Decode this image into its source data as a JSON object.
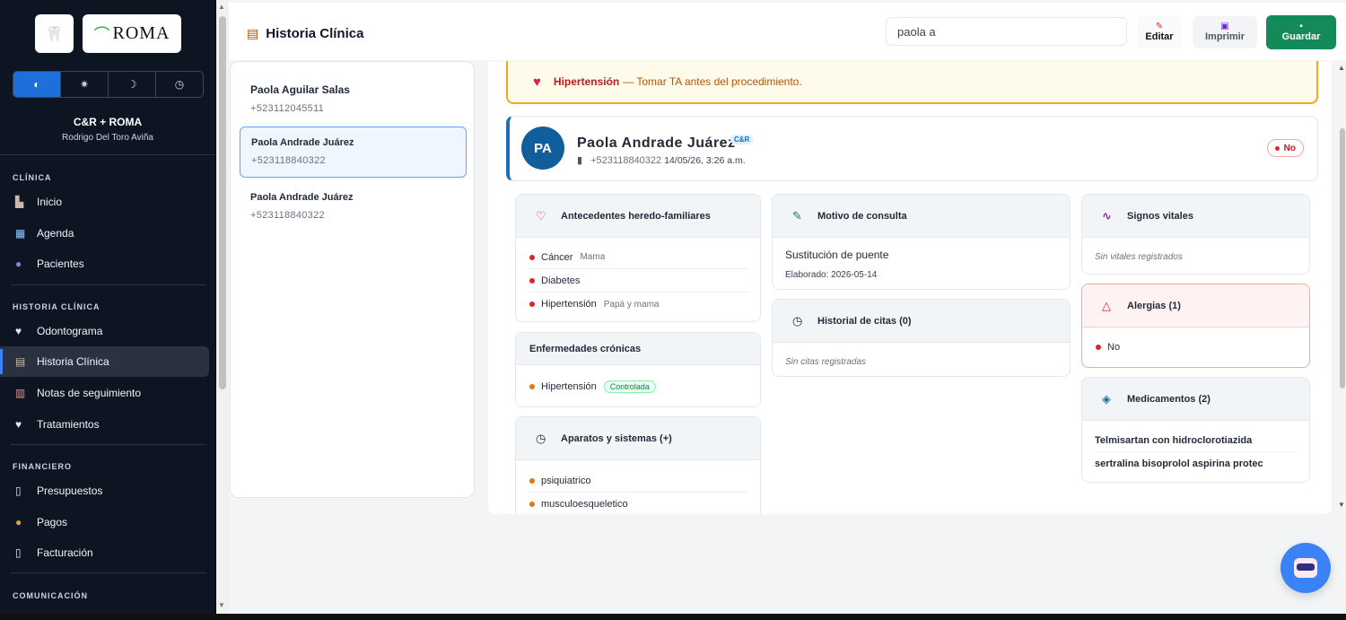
{
  "sidebar": {
    "logo_small_text": "C&R",
    "logo_brand": "ROMA",
    "theme_options": [
      {
        "icon": "contrast-icon",
        "glyph": "◐"
      },
      {
        "icon": "sun-icon",
        "glyph": "✷"
      },
      {
        "icon": "moon-icon",
        "glyph": "☽"
      },
      {
        "icon": "clock-icon",
        "glyph": "◷"
      }
    ],
    "clinic_name": "C&R + ROMA",
    "user_name": "Rodrigo Del Toro Aviña",
    "sections": {
      "clinica": "CLÍNICA",
      "historia": "HISTORIA CLÍNICA",
      "financiero": "FINANCIERO",
      "comunicacion": "COMUNICACIÓN"
    },
    "items": {
      "inicio": "Inicio",
      "agenda": "Agenda",
      "pacientes": "Pacientes",
      "odontograma": "Odontograma",
      "historia_clinica": "Historia Clínica",
      "notas": "Notas de seguimiento",
      "tratamientos": "Tratamientos",
      "presupuestos": "Presupuestos",
      "pagos": "Pagos",
      "facturacion": "Facturación"
    }
  },
  "header": {
    "title": "Historia Clínica",
    "search_value": "paola a",
    "edit_label": "Editar",
    "print_label": "Imprimir",
    "save_label": "Guardar"
  },
  "patients": [
    {
      "name": "Paola Aguilar Salas",
      "phone": "+523112045511"
    },
    {
      "name": "Paola Andrade Juárez",
      "phone": "+523118840322"
    },
    {
      "name": "Paola Andrade Juárez",
      "phone": "+523118840322"
    }
  ],
  "alert": {
    "condition": "Hipertensión",
    "message": "— Tomar TA antes del procedimiento."
  },
  "patient": {
    "initials": "PA",
    "name": "Paola Andrade Juárez",
    "tag": "C&R",
    "phone": "+523118840322",
    "date": "14/05/26, 3:26 a.m.",
    "status": "No"
  },
  "antecedentes": {
    "title": "Antecedentes heredo-familiares",
    "items": [
      {
        "name": "Cáncer",
        "detail": "Mama"
      },
      {
        "name": "Diabetes",
        "detail": ""
      },
      {
        "name": "Hipertensión",
        "detail": "Papá y mama"
      }
    ]
  },
  "cronicas": {
    "title": "Enfermedades crónicas",
    "items": [
      {
        "name": "Hipertensión",
        "status": "Controlada"
      }
    ]
  },
  "aparatos": {
    "title": "Aparatos y sistemas (+)",
    "items": [
      "psiquiatrico",
      "musculoesqueletico"
    ]
  },
  "motivo": {
    "title": "Motivo de consulta",
    "text": "Sustitución de puente",
    "elaborado": "Elaborado: 2026-05-14"
  },
  "citas": {
    "title": "Historial de citas (0)",
    "empty": "Sin citas registradas"
  },
  "vitales": {
    "title": "Signos vitales",
    "empty": "Sin vitales registrados"
  },
  "alergias": {
    "title": "Alergias (1)",
    "items": [
      "No"
    ]
  },
  "medicamentos": {
    "title": "Medicamentos (2)",
    "items": [
      "Telmisartan con hidroclorotiazida",
      "sertralina bisoprolol aspirina protec"
    ]
  },
  "colors": {
    "accent": "#1e6fd9",
    "save": "#148a5a",
    "alert_border": "#f5a623",
    "sidebar_bg": "#0e1522"
  }
}
